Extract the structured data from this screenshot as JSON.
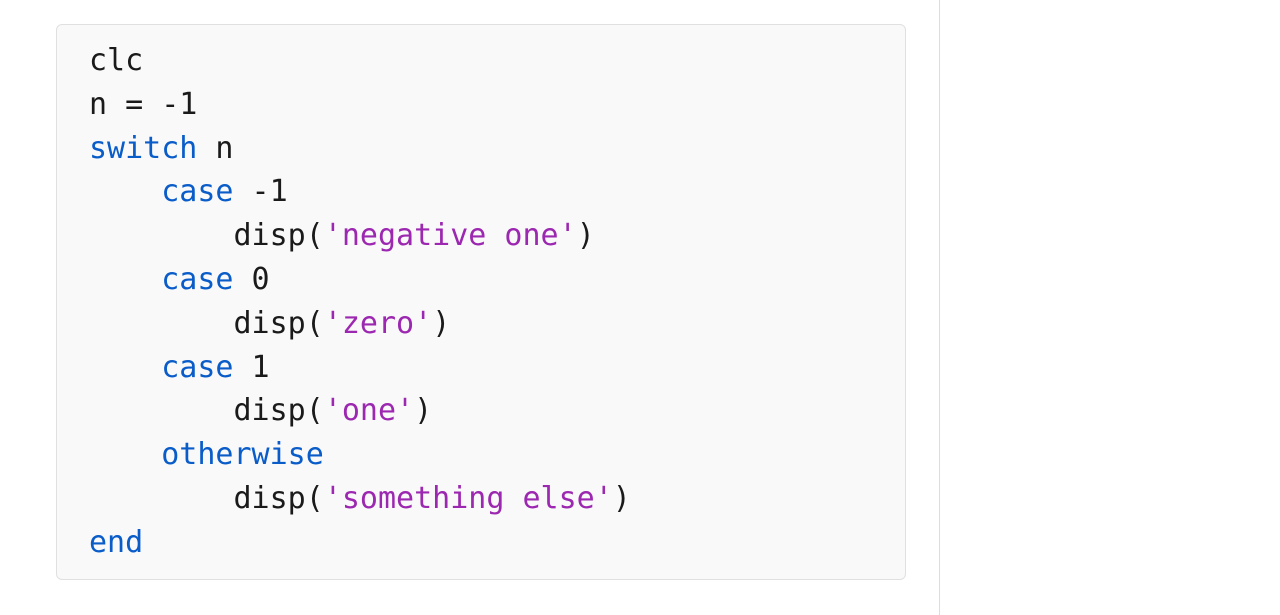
{
  "code": {
    "line1": "clc",
    "line2_a": "n = ",
    "line2_b": "-1",
    "line3_kw": "switch",
    "line3_rest": " n",
    "line4_indent": "    ",
    "line4_kw": "case",
    "line4_rest": " -1",
    "line5_indent": "        ",
    "line5_a": "disp(",
    "line5_str": "'negative one'",
    "line5_b": ")",
    "line6_indent": "    ",
    "line6_kw": "case",
    "line6_rest": " 0",
    "line7_indent": "        ",
    "line7_a": "disp(",
    "line7_str": "'zero'",
    "line7_b": ")",
    "line8_indent": "    ",
    "line8_kw": "case",
    "line8_rest": " 1",
    "line9_indent": "        ",
    "line9_a": "disp(",
    "line9_str": "'one'",
    "line9_b": ")",
    "line10_indent": "    ",
    "line10_kw": "otherwise",
    "line11_indent": "        ",
    "line11_a": "disp(",
    "line11_str": "'something else'",
    "line11_b": ")",
    "line12_kw": "end"
  }
}
